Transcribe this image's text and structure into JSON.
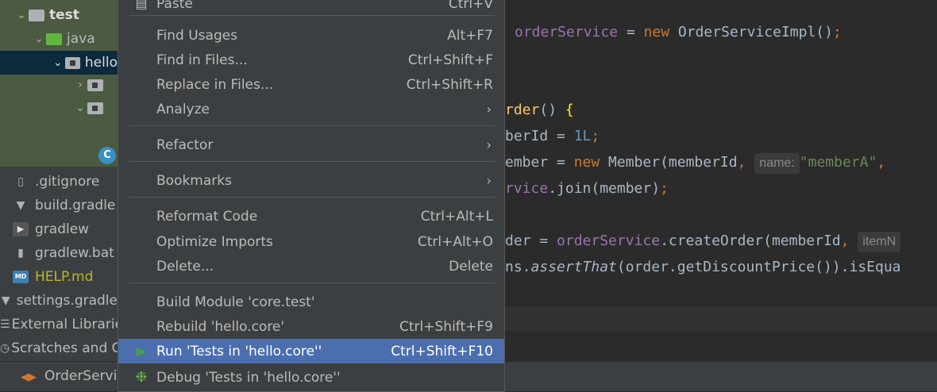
{
  "project_tree": {
    "rows": [
      {
        "name": "test",
        "type": "folder"
      },
      {
        "name": "java",
        "type": "source-folder"
      },
      {
        "name": "hello",
        "type": "package"
      },
      {
        "name": "",
        "type": "package"
      },
      {
        "name": "",
        "type": "package"
      }
    ],
    "files": [
      {
        "name": ".gitignore",
        "icon": "gitignore-icon"
      },
      {
        "name": "build.gradle",
        "icon": "gradle-elephant-icon"
      },
      {
        "name": "gradlew",
        "icon": "terminal-icon"
      },
      {
        "name": "gradlew.bat",
        "icon": "file-icon"
      },
      {
        "name": "HELP.md",
        "icon": "markdown-icon"
      },
      {
        "name": "settings.gradle",
        "icon": "gradle-elephant-icon"
      },
      {
        "name": "External Libraries",
        "icon": "library-icon"
      },
      {
        "name": "Scratches and Consoles",
        "icon": "scratches-icon"
      }
    ],
    "md_badge": "MD",
    "class_badge": "C"
  },
  "editor": {
    "hint_name": "name:",
    "hint_item": "itemN"
  },
  "bottom_bar": {
    "run_tab_label": "OrderServiceTest"
  },
  "context_menu": {
    "paste": {
      "label": "Paste",
      "shortcut": "Ctrl+V"
    },
    "find_usages": {
      "label": "Find Usages",
      "shortcut": "Alt+F7"
    },
    "find_in_files": {
      "label": "Find in Files...",
      "shortcut": "Ctrl+Shift+F"
    },
    "replace_in_files": {
      "label": "Replace in Files...",
      "shortcut": "Ctrl+Shift+R"
    },
    "analyze": {
      "label": "Analyze"
    },
    "refactor": {
      "label": "Refactor"
    },
    "bookmarks": {
      "label": "Bookmarks"
    },
    "reformat_code": {
      "label": "Reformat Code",
      "shortcut": "Ctrl+Alt+L"
    },
    "optimize_imports": {
      "label": "Optimize Imports",
      "shortcut": "Ctrl+Alt+O"
    },
    "delete": {
      "label": "Delete...",
      "shortcut": "Delete"
    },
    "build_module": {
      "label": "Build Module 'core.test'"
    },
    "rebuild": {
      "label": "Rebuild 'hello.core'",
      "shortcut": "Ctrl+Shift+F9"
    },
    "run": {
      "label": "Run 'Tests in 'hello.core''",
      "shortcut": "Ctrl+Shift+F10"
    },
    "debug": {
      "label": "Debug 'Tests in 'hello.core''"
    }
  },
  "colors": {
    "menu_highlight": "#4b6eaf",
    "run_icon": "#499c54",
    "debug_icon": "#62b543"
  }
}
